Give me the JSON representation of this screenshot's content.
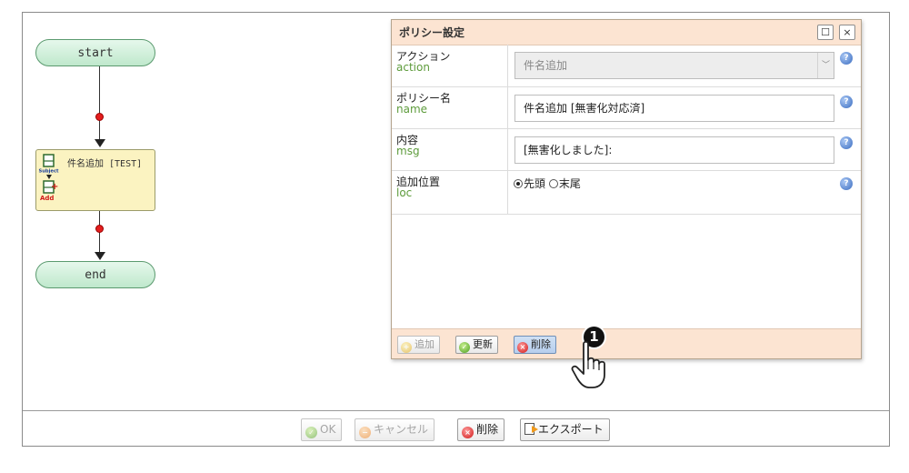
{
  "flow": {
    "start_label": "start",
    "end_label": "end",
    "action_node": {
      "label": "件名追加 [TEST]",
      "icon_top_text": "Subject",
      "icon_bottom_text": "Add"
    }
  },
  "dialog": {
    "title": "ポリシー設定",
    "maximize_symbol": "☐",
    "close_symbol": "×",
    "help_symbol": "?",
    "fields": [
      {
        "label_jp": "アクション",
        "label_en": "action",
        "value": "件名追加",
        "disabled": true,
        "type": "select"
      },
      {
        "label_jp": "ポリシー名",
        "label_en": "name",
        "value": "件名追加 [無害化対応済]",
        "type": "text"
      },
      {
        "label_jp": "内容",
        "label_en": "msg",
        "value": "[無害化しました]:",
        "type": "text"
      },
      {
        "label_jp": "追加位置",
        "label_en": "loc",
        "type": "radio",
        "options": [
          {
            "label": "先頭",
            "selected": true
          },
          {
            "label": "末尾",
            "selected": false
          }
        ]
      }
    ],
    "buttons": {
      "add": "追加",
      "update": "更新",
      "delete": "削除"
    }
  },
  "annotation": {
    "step": "1"
  },
  "bottom_bar": {
    "ok": "OK",
    "cancel": "キャンセル",
    "delete": "削除",
    "export": "エクスポート"
  },
  "colors": {
    "dialog_header": "#fce4d2",
    "flow_node_green": "#bfe8cc",
    "action_node_yellow": "#fbf3c1",
    "english_label_green": "#5d9b3b",
    "connector_dot_red": "#e31e1e"
  }
}
